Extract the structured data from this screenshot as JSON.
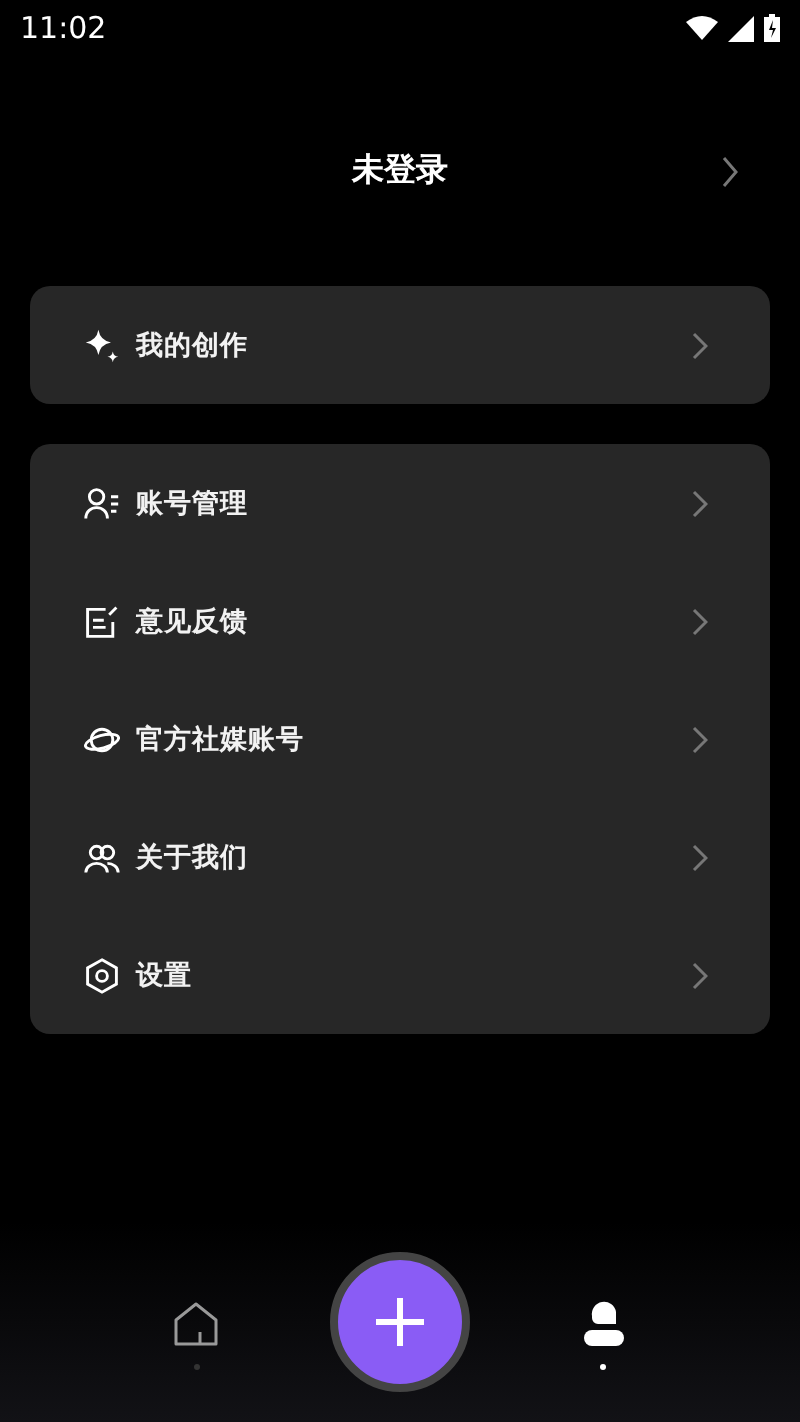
{
  "status_bar": {
    "time": "11:02"
  },
  "header": {
    "title": "未登录"
  },
  "cards": [
    {
      "items": [
        {
          "label": "我的创作"
        }
      ]
    },
    {
      "items": [
        {
          "label": "账号管理"
        },
        {
          "label": "意见反馈"
        },
        {
          "label": "官方社媒账号"
        },
        {
          "label": "关于我们"
        },
        {
          "label": "设置"
        }
      ]
    }
  ],
  "nav": [
    {
      "kind": "tab",
      "selected": false
    },
    {
      "kind": "button"
    },
    {
      "kind": "tab",
      "selected": true
    }
  ]
}
